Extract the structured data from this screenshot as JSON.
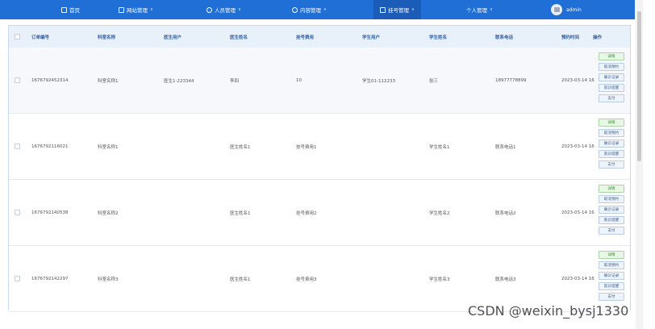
{
  "nav": {
    "items": [
      {
        "label": "首页"
      },
      {
        "label": "网站管理"
      },
      {
        "label": "人员管理"
      },
      {
        "label": "内容管理"
      },
      {
        "label": "挂号管理"
      },
      {
        "label": "个人管理"
      }
    ],
    "user": "admin"
  },
  "table": {
    "headers": [
      "订单编号",
      "科室名称",
      "医生用户",
      "医生姓名",
      "挂号费用",
      "学生用户",
      "学生姓名",
      "联系电话",
      "预约时间",
      "操作"
    ],
    "rows": [
      [
        "1676792452314",
        "科室名称1",
        "医生1-223344",
        "李四",
        "10",
        "学生01-112233",
        "张三",
        "18977778899",
        "2023-03-14 16"
      ],
      [
        "1676792116021",
        "科室名称1",
        "",
        "医生姓名1",
        "挂号费用1",
        "",
        "学生姓名1",
        "联系电话1",
        "2023-03-14 16"
      ],
      [
        "1676792140538",
        "科室名称2",
        "",
        "医生姓名1",
        "挂号费用2",
        "",
        "学生姓名2",
        "联系电话2",
        "2023-03-14 16"
      ],
      [
        "1676792142297",
        "科室名称3",
        "",
        "医生姓名1",
        "挂号费用3",
        "",
        "学生姓名3",
        "联系电话3",
        "2023-03-14 16"
      ]
    ],
    "actions": [
      "详情",
      "取消预约",
      "确诊记录",
      "就诊提醒",
      "支付"
    ]
  },
  "watermark": "CSDN @weixin_bysj1330"
}
